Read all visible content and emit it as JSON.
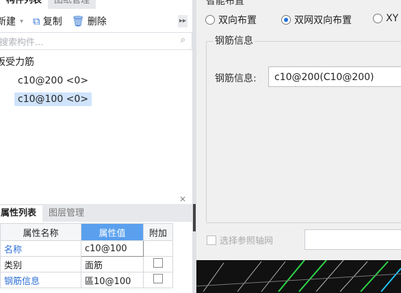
{
  "left_tabs": {
    "active": "构件列表",
    "inactive": "图纸管理"
  },
  "toolbar": {
    "new_label": "新建",
    "copy_label": "复制",
    "delete_label": "删除"
  },
  "search": {
    "placeholder": "搜索构件..."
  },
  "tree": {
    "group_label": "板受力筋",
    "items": [
      "c10@200 <0>",
      "c10@100 <0>"
    ],
    "selected_index": 1
  },
  "prop_tabs": {
    "active": "属性列表",
    "inactive": "图层管理"
  },
  "props": {
    "headers": [
      "属性名称",
      "属性值",
      "附加"
    ],
    "rows": [
      {
        "name": "名称",
        "value": "c10@100",
        "addable": false
      },
      {
        "name": "类别",
        "value": "面筋",
        "addable": true
      },
      {
        "name": "钢筋信息",
        "value": "區10@100",
        "addable": true
      }
    ]
  },
  "dialog": {
    "title_partial": "智能布置",
    "radios": [
      {
        "label": "双向布置",
        "checked": false
      },
      {
        "label": "双网双向布置",
        "checked": true
      },
      {
        "label": "XY",
        "checked": false
      }
    ],
    "group_legend": "钢筋信息",
    "rebar_label": "钢筋信息:",
    "rebar_value": "c10@200(C10@200)",
    "ref_axis_checkbox_label": "选择参照轴网"
  },
  "colors": {
    "accent": "#1e6fd9",
    "selected_bg": "#cfe3fb",
    "header_value_bg": "#5aa0ee",
    "link_blue": "#2d6fd6"
  }
}
